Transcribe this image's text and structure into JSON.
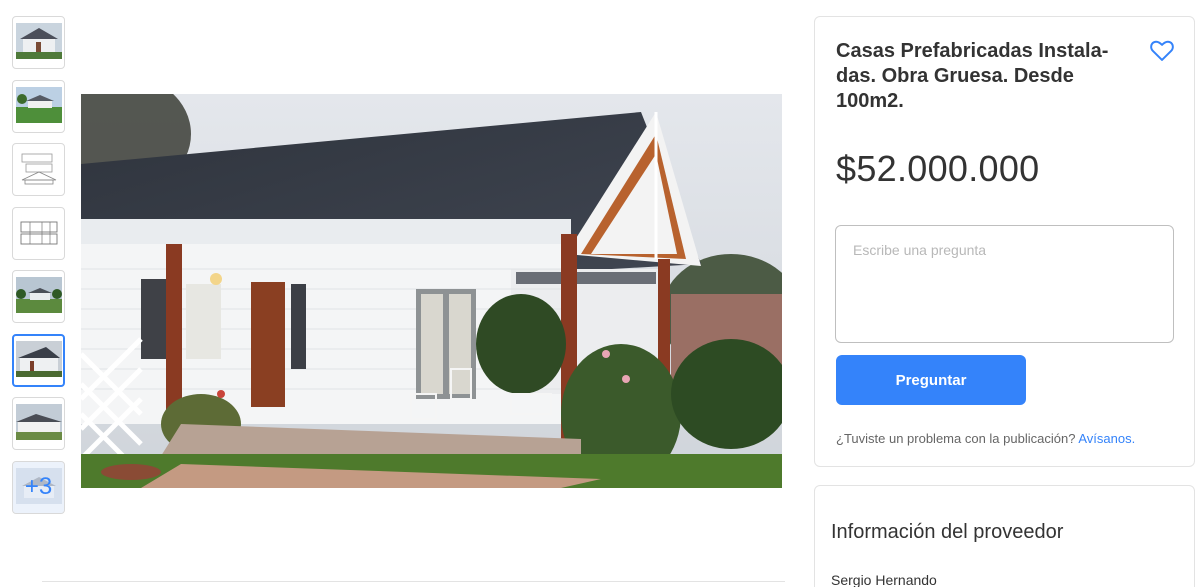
{
  "gallery": {
    "thumbnails": [
      {
        "alt": "casa-frente"
      },
      {
        "alt": "casa-jardin"
      },
      {
        "alt": "plano-fachada"
      },
      {
        "alt": "plano-planta"
      },
      {
        "alt": "casa-lejos"
      },
      {
        "alt": "casa-seleccionada"
      },
      {
        "alt": "casa-lateral"
      },
      {
        "alt": "mas-fotos"
      }
    ],
    "more_label": "+3",
    "selected_index": 5
  },
  "listing": {
    "title": "Casas Prefabricadas Instala-das. Obra Gruesa. Desde 100m2.",
    "price": "$52.000.000"
  },
  "question": {
    "placeholder": "Escribe una pregunta",
    "value": "",
    "button_label": "Preguntar"
  },
  "report": {
    "text": "¿Tuviste un problema con la publicación?",
    "link": "Avísanos."
  },
  "provider": {
    "heading": "Información del proveedor",
    "name": "Sergio Hernando"
  },
  "colors": {
    "accent": "#3483fa",
    "text": "#333333",
    "border": "#e3e3e3"
  }
}
